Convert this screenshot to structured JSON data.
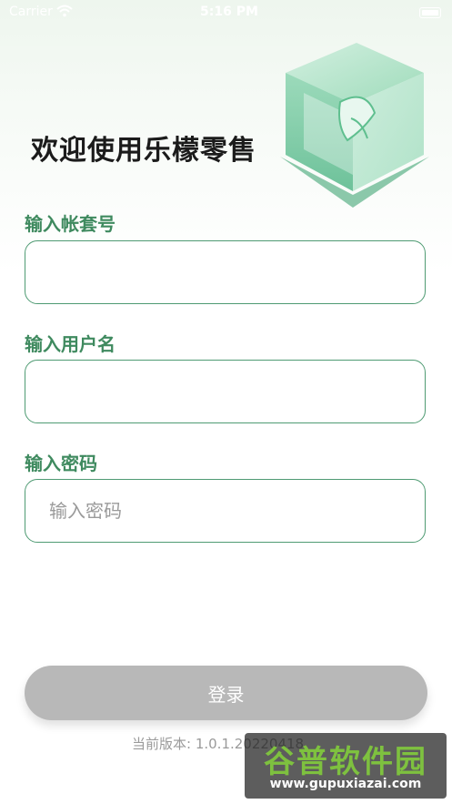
{
  "status_bar": {
    "carrier": "Carrier",
    "time": "5:16 PM"
  },
  "header": {
    "title": "欢迎使用乐檬零售"
  },
  "form": {
    "account_label": "输入帐套号",
    "account_value": "",
    "username_label": "输入用户名",
    "username_value": "",
    "password_label": "输入密码",
    "password_placeholder": "输入密码"
  },
  "actions": {
    "login_label": "登录"
  },
  "footer": {
    "version_text": "当前版本: 1.0.1.20220418"
  },
  "watermark": {
    "title": "谷普软件园",
    "url": "www.gupuxiazai.com"
  },
  "colors": {
    "accent": "#3f8a5f",
    "field_border": "#4f9b73",
    "button_disabled": "#b8b8b8"
  }
}
